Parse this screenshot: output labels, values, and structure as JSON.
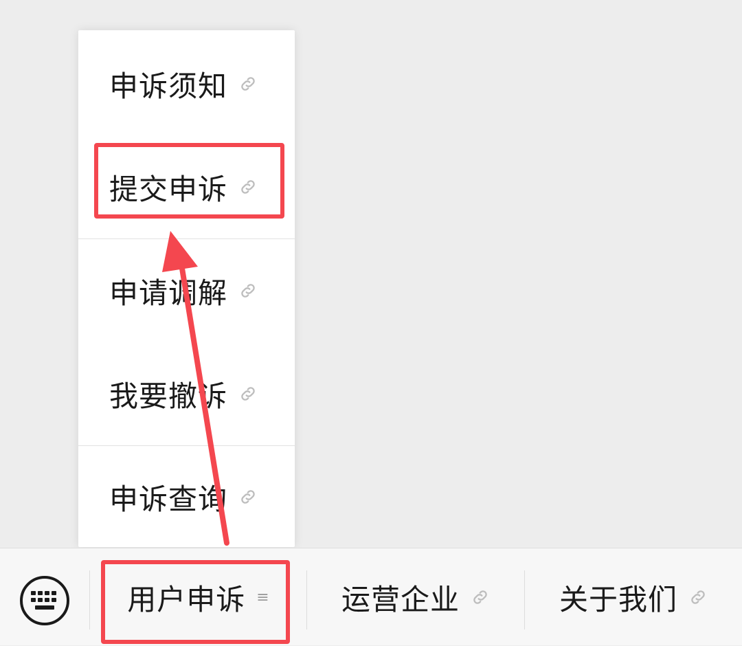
{
  "submenu": {
    "items": [
      {
        "label": "申诉须知",
        "icon": "link-icon"
      },
      {
        "label": "提交申诉",
        "icon": "link-icon"
      },
      {
        "label": "申请调解",
        "icon": "link-icon"
      },
      {
        "label": "我要撤诉",
        "icon": "link-icon"
      },
      {
        "label": "申诉查询",
        "icon": "link-icon"
      }
    ]
  },
  "menu_bar": {
    "keyboard_icon": "keyboard-icon",
    "items": [
      {
        "label": "用户申诉",
        "icon": "menu-lines-icon",
        "icon_glyph": "≡"
      },
      {
        "label": "运营企业",
        "icon": "link-icon"
      },
      {
        "label": "关于我们",
        "icon": "link-icon"
      }
    ]
  },
  "annotation": {
    "color": "#f4474f"
  }
}
